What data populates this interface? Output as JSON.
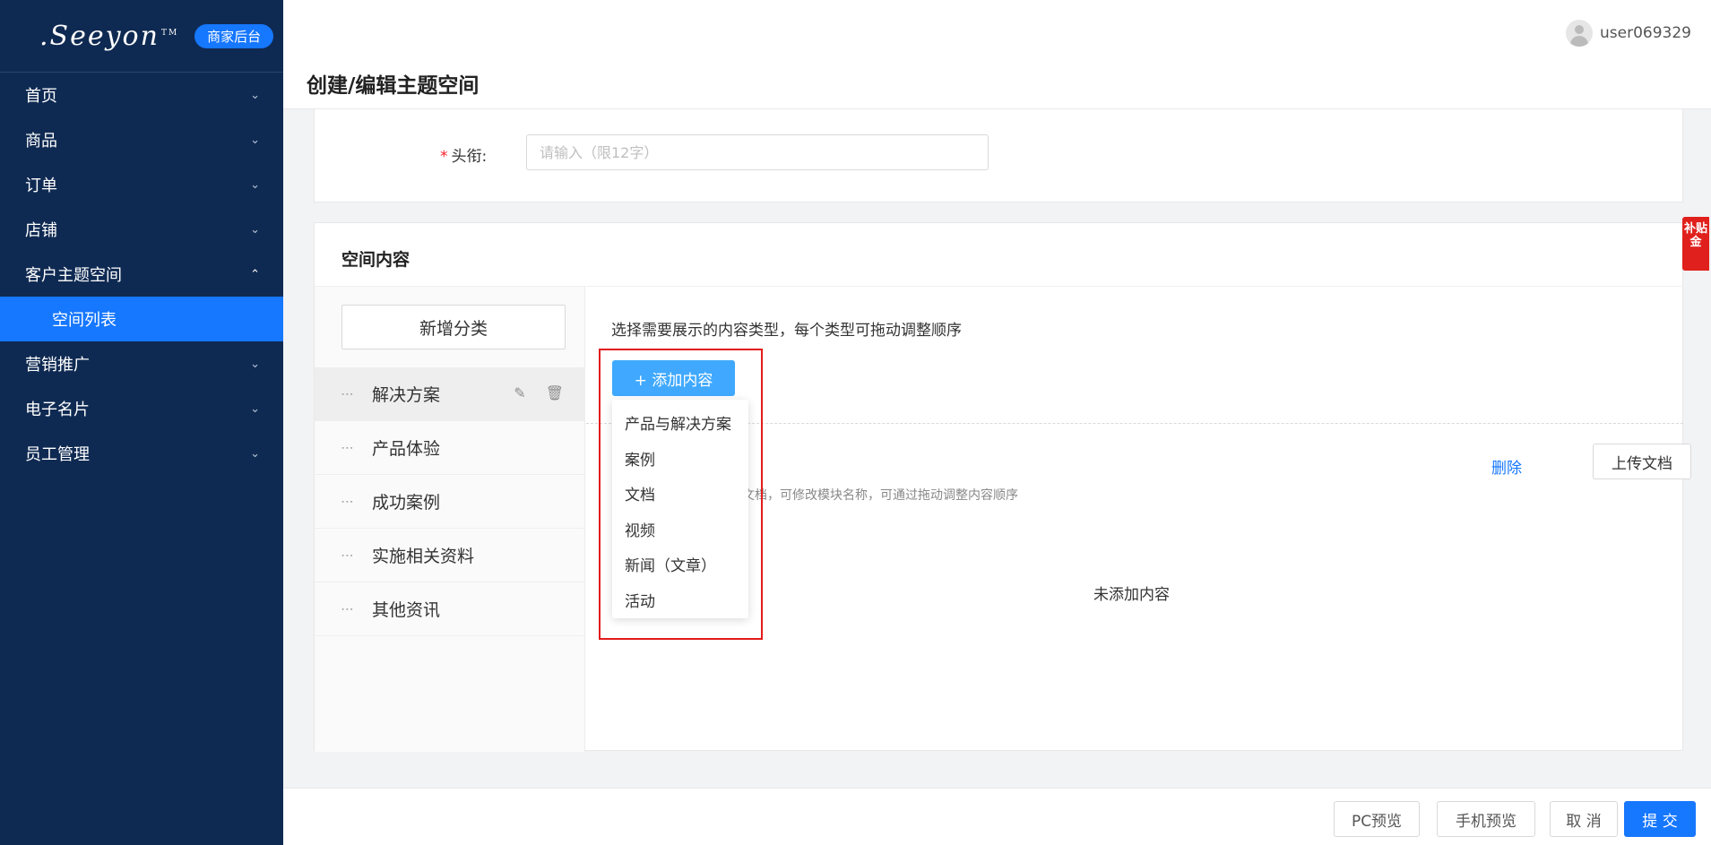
{
  "sidebar": {
    "logo": ".Seeyon",
    "logo_tm": "TM",
    "badge": "商家后台",
    "items": [
      {
        "label": "首页"
      },
      {
        "label": "商品"
      },
      {
        "label": "订单"
      },
      {
        "label": "店铺"
      },
      {
        "label": "客户主题空间",
        "open": true
      },
      {
        "label": "营销推广"
      },
      {
        "label": "电子名片"
      },
      {
        "label": "员工管理"
      }
    ],
    "sub_item": "空间列表"
  },
  "header": {
    "title": "创建/编辑主题空间",
    "username": "user069329"
  },
  "form": {
    "title_label": "头衔:",
    "title_required": "*",
    "title_placeholder": "请输入（限12字）"
  },
  "space": {
    "section_title": "空间内容",
    "add_category_label": "新增分类",
    "categories": [
      {
        "label": "解决方案",
        "active": true
      },
      {
        "label": "产品体验"
      },
      {
        "label": "成功案例"
      },
      {
        "label": "实施相关资料"
      },
      {
        "label": "其他资讯"
      }
    ],
    "hint": "选择需要展示的内容类型，每个类型可拖动调整顺序",
    "add_content_label": "添加内容",
    "dropdown_items": [
      "产品与解决方案",
      "案例",
      "文档",
      "视频",
      "新闻（文章）",
      "活动"
    ],
    "module_desc": "案等文档，可修改模块名称，可通过拖动调整内容顺序",
    "delete_label": "删除",
    "upload_label": "上传文档",
    "empty_text": "未添加内容"
  },
  "footer": {
    "pc_preview": "PC预览",
    "mobile_preview": "手机预览",
    "cancel": "取 消",
    "submit": "提 交"
  },
  "subsidy_label": "补贴金",
  "colors": {
    "sidebar_bg": "#0f2a52",
    "primary": "#1677ff",
    "highlight_box": "#e31b1b"
  }
}
